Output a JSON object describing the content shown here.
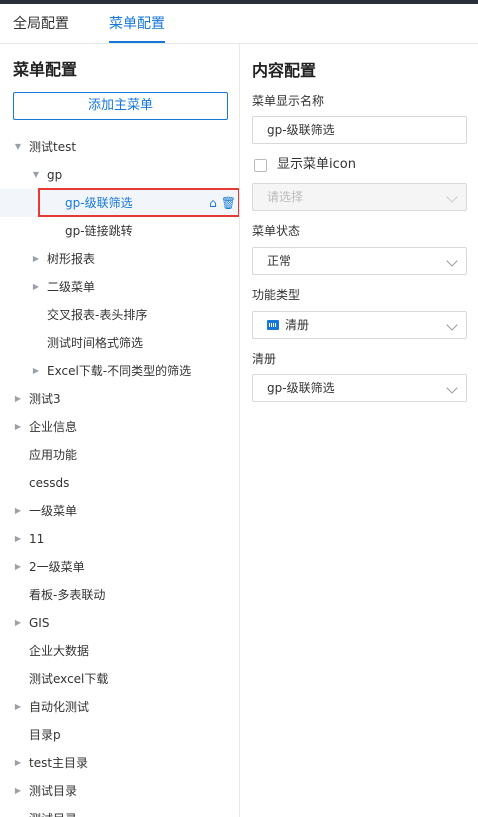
{
  "tabs": [
    "全局配置",
    "菜单配置"
  ],
  "left": {
    "title": "菜单配置",
    "add_button": "添加主菜单",
    "tree": [
      {
        "label": "测试test",
        "arrow": "down",
        "indent": 0
      },
      {
        "label": "gp",
        "arrow": "down",
        "indent": 1
      },
      {
        "label": "gp-级联筛选",
        "arrow": "",
        "indent": 2,
        "selected": true
      },
      {
        "label": "gp-链接跳转",
        "arrow": "",
        "indent": 2
      },
      {
        "label": "树形报表",
        "arrow": "right",
        "indent": 1
      },
      {
        "label": "二级菜单",
        "arrow": "right",
        "indent": 1
      },
      {
        "label": "交叉报表-表头排序",
        "arrow": "",
        "indent": 1
      },
      {
        "label": "测试时间格式筛选",
        "arrow": "",
        "indent": 1
      },
      {
        "label": "Excel下载-不同类型的筛选",
        "arrow": "right",
        "indent": 1
      },
      {
        "label": "测试3",
        "arrow": "right",
        "indent": 0
      },
      {
        "label": "企业信息",
        "arrow": "right",
        "indent": 0
      },
      {
        "label": "应用功能",
        "arrow": "",
        "indent": 0
      },
      {
        "label": "cessds",
        "arrow": "",
        "indent": 0
      },
      {
        "label": "一级菜单",
        "arrow": "right",
        "indent": 0
      },
      {
        "label": "11",
        "arrow": "right",
        "indent": 0
      },
      {
        "label": "2一级菜单",
        "arrow": "right",
        "indent": 0
      },
      {
        "label": "看板-多表联动",
        "arrow": "",
        "indent": 0
      },
      {
        "label": "GIS",
        "arrow": "right",
        "indent": 0
      },
      {
        "label": "企业大数据",
        "arrow": "",
        "indent": 0
      },
      {
        "label": "测试excel下载",
        "arrow": "",
        "indent": 0
      },
      {
        "label": "自动化测试",
        "arrow": "right",
        "indent": 0
      },
      {
        "label": "目录p",
        "arrow": "",
        "indent": 0
      },
      {
        "label": "test主目录",
        "arrow": "right",
        "indent": 0
      },
      {
        "label": "测试目录",
        "arrow": "right",
        "indent": 0
      },
      {
        "label": "测试目录",
        "arrow": "",
        "indent": 0
      }
    ],
    "selected_icons": [
      "home-icon",
      "trash-icon"
    ]
  },
  "right": {
    "title": "内容配置",
    "name_label": "菜单显示名称",
    "name_value": "gp-级联筛选",
    "show_icon_label": "显示菜单icon",
    "icon_placeholder": "请选择",
    "status_label": "菜单状态",
    "status_value": "正常",
    "type_label": "功能类型",
    "type_value": "清册",
    "list_label": "清册",
    "list_value": "gp-级联筛选"
  },
  "colors": {
    "accent": "#1677d9",
    "highlight_border": "#e53935"
  }
}
